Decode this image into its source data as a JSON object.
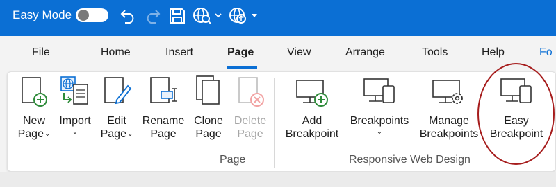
{
  "titlebar": {
    "easy_mode_label": "Easy Mode",
    "toggle_state": "off",
    "colors": {
      "bar": "#0b6fd4",
      "text": "#ffffff"
    },
    "quick_access": [
      "undo-icon",
      "redo-icon",
      "save-icon",
      "web-preview-icon",
      "publish-icon"
    ]
  },
  "tabs": {
    "items": [
      "File",
      "Home",
      "Insert",
      "Page",
      "View",
      "Arrange",
      "Tools",
      "Help",
      "Fo"
    ],
    "active": "Page"
  },
  "ribbon": {
    "groups": {
      "page": "Page",
      "responsive": "Responsive Web Design"
    },
    "buttons": {
      "new_page": {
        "line1": "New",
        "line2": "Page",
        "caret": "⌄"
      },
      "import": {
        "line1": "Import",
        "caret": "⌄"
      },
      "edit_page": {
        "line1": "Edit",
        "line2": "Page",
        "caret": "⌄"
      },
      "rename_page": {
        "line1": "Rename",
        "line2": "Page"
      },
      "clone_page": {
        "line1": "Clone",
        "line2": "Page"
      },
      "delete_page": {
        "line1": "Delete",
        "line2": "Page",
        "disabled": true
      },
      "add_breakpoint": {
        "line1": "Add",
        "line2": "Breakpoint"
      },
      "breakpoints": {
        "line1": "Breakpoints",
        "caret": "⌄"
      },
      "manage_breakpoints": {
        "line1": "Manage",
        "line2": "Breakpoints"
      },
      "easy_breakpoint": {
        "line1": "Easy",
        "line2": "Breakpoint",
        "highlighted": true
      }
    }
  }
}
